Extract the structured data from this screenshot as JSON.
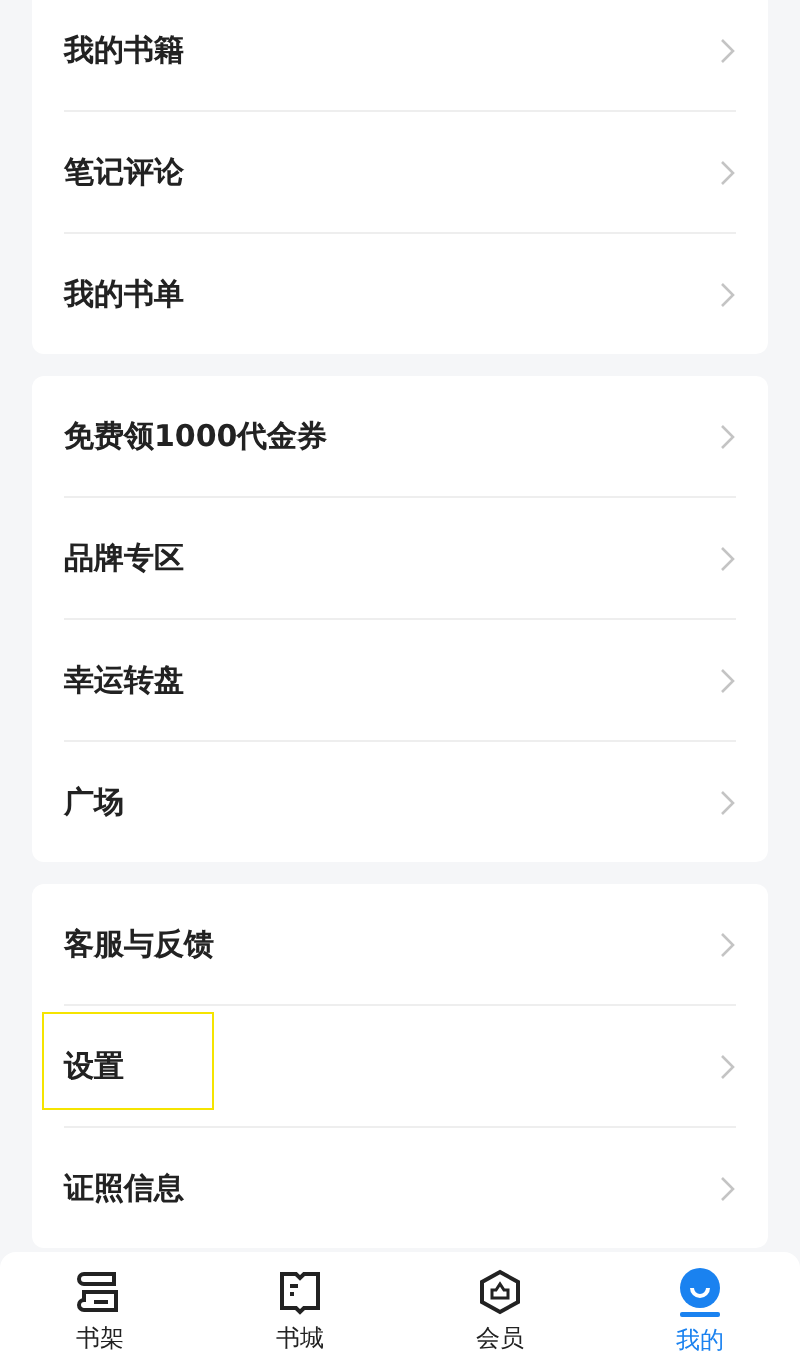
{
  "sections": [
    {
      "items": [
        {
          "label": "我的书籍",
          "highlighted": false
        },
        {
          "label": "笔记评论",
          "highlighted": false
        },
        {
          "label": "我的书单",
          "highlighted": false
        }
      ]
    },
    {
      "items": [
        {
          "label": "免费领1000代金券",
          "highlighted": false
        },
        {
          "label": "品牌专区",
          "highlighted": false
        },
        {
          "label": "幸运转盘",
          "highlighted": false
        },
        {
          "label": "广场",
          "highlighted": false
        }
      ]
    },
    {
      "items": [
        {
          "label": "客服与反馈",
          "highlighted": false
        },
        {
          "label": "设置",
          "highlighted": true
        },
        {
          "label": "证照信息",
          "highlighted": false
        }
      ]
    }
  ],
  "tab_bar": [
    {
      "kind": "shelf",
      "label": "书架",
      "selected": false
    },
    {
      "kind": "store",
      "label": "书城",
      "selected": false
    },
    {
      "kind": "member",
      "label": "会员",
      "selected": false
    },
    {
      "kind": "profile",
      "label": "我的",
      "selected": true
    }
  ]
}
